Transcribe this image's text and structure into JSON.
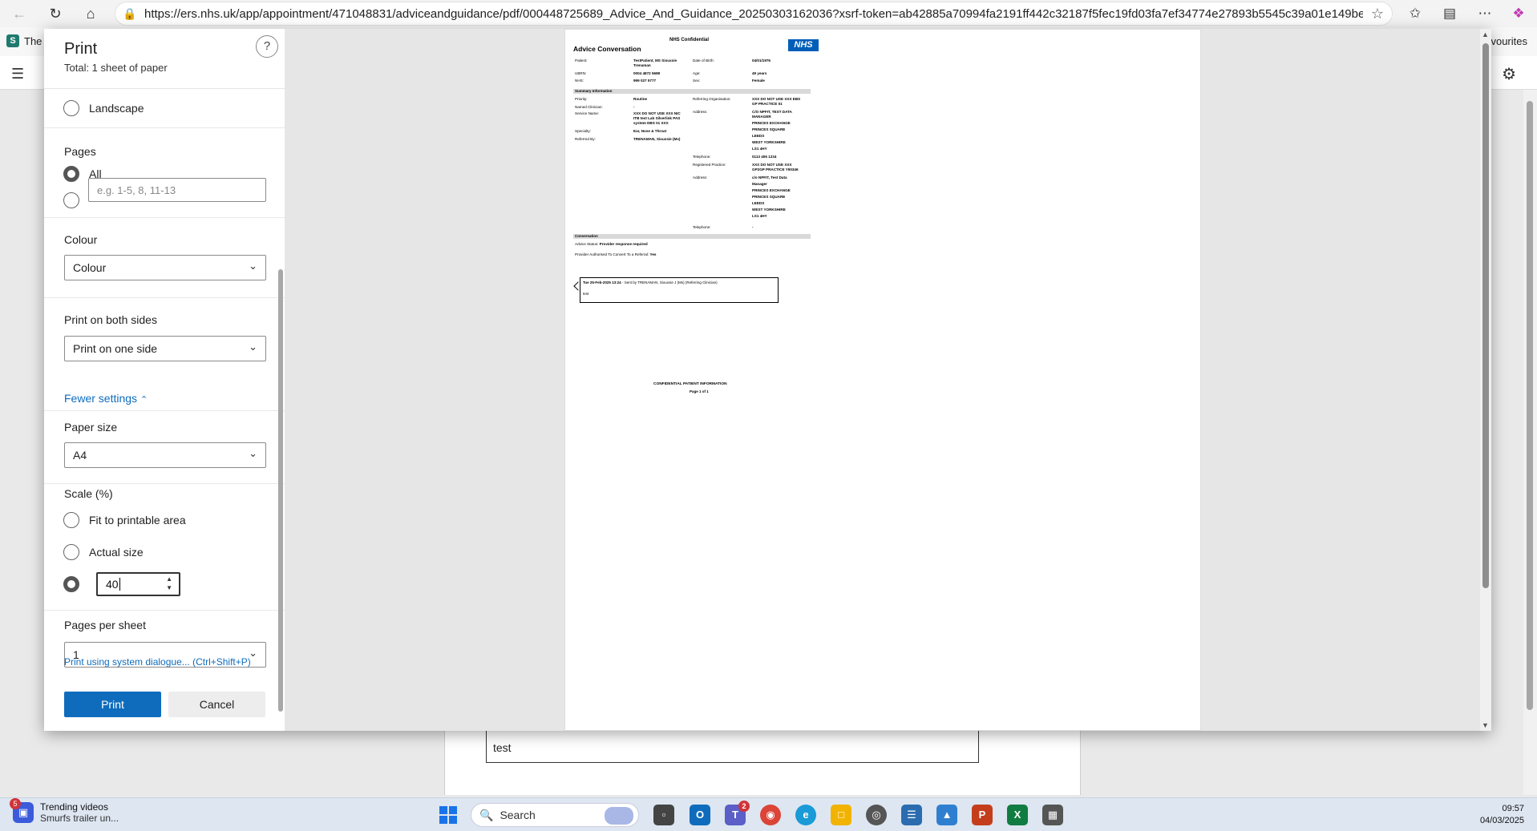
{
  "browser": {
    "url": "https://ers.nhs.uk/app/appointment/471048831/adviceandguidance/pdf/000448725689_Advice_And_Guidance_20250303162036?xsrf-token=ab42885a70994fa2191ff442c32187f5fec19fd03fa7ef34774e27893b5545c39a01e149bec8fc9556d18...",
    "fav_left": "The",
    "fav_right": "vourites"
  },
  "print": {
    "title": "Print",
    "subtitle": "Total: 1 sheet of paper",
    "help": "?",
    "landscape_label": "Landscape",
    "pages_label": "Pages",
    "pages_all": "All",
    "pages_placeholder": "e.g. 1-5, 8, 11-13",
    "colour_label": "Colour",
    "colour_value": "Colour",
    "both_sides_label": "Print on both sides",
    "both_sides_value": "Print on one side",
    "fewer_settings": "Fewer settings",
    "paper_size_label": "Paper size",
    "paper_size_value": "A4",
    "scale_label": "Scale (%)",
    "scale_fit": "Fit to printable area",
    "scale_actual": "Actual size",
    "scale_value": "40",
    "pps_label": "Pages per sheet",
    "pps_value": "1",
    "system_dialog": "Print using system dialogue... (Ctrl+Shift+P)",
    "print_btn": "Print",
    "cancel_btn": "Cancel"
  },
  "doc": {
    "confidential": "NHS Confidential",
    "title": "Advice Conversation",
    "nhs": "NHS",
    "patient_k": "Patient:",
    "patient_v1": "TestPatient, MS Siouxsie",
    "patient_v2": "Trenaman",
    "dob_k": "Date of Birth:",
    "dob_v": "04/01/1976",
    "ubrn_k": "UBRN:",
    "ubrn_v": "0004 4872 5689",
    "age_k": "Age:",
    "age_v": "49 years",
    "nhs_k": "NHS:",
    "nhs_v": "999 027 5777",
    "sex_k": "Sex:",
    "sex_v": "Female",
    "summary": "Summary Information",
    "priority_k": "Priority:",
    "priority_v": "Routine",
    "ref_org_k": "Referring Organisation:",
    "ref_org_v1": "XXX DO NOT USE XXX EBS",
    "ref_org_v2": "GP PRACTICE 01",
    "named_k": "Named Clinician:",
    "named_v": "-",
    "service_k": "Service Name:",
    "service_v1": "XXX DO NOT USE XXX NIC",
    "service_v2": "ITB test Lab Silverlink PAS",
    "service_v3": "system DBS 01 XXX",
    "address_k": "Address:",
    "addr1_1": "C/O NPFIT, TEST DATA",
    "addr1_2": "MANAGER",
    "addr1_3": "PRINCES EXCHANGE",
    "addr1_4": "PRINCES SQUARE",
    "addr1_5": "LEEDS",
    "addr1_6": "WEST YORKSHIRE",
    "addr1_7": "LS1 4HY",
    "specialty_k": "Specialty:",
    "specialty_v": "Ear, Nose & Throat",
    "referred_k": "Referred By:",
    "referred_v": "TRENAMAN, Siouxsie (Ms)",
    "tel_k": "Telephone:",
    "tel_v": "0113 406 1234",
    "reg_k": "Registered Practice:",
    "reg_v1": "XXX DO NOT USE XXX",
    "reg_v2": "GP2GP PRACTICE Y90346",
    "addr2_1": "c/o NPFIT, Test Data",
    "addr2_2": "Manager",
    "addr2_3": "PRINCES EXCHANGE",
    "addr2_4": "PRINCES SQUARE",
    "addr2_5": "LEEDS",
    "addr2_6": "WEST YORKSHIRE",
    "addr2_7": "LS1 4HY",
    "tel2_v": "-",
    "conversation": "Conversation",
    "advice_status_k": "Advice Status:",
    "advice_status_v": "Provider response required",
    "authorised_k": "Provider Authorised To Convert To a Referral:",
    "authorised_v": "Yes",
    "msg_head": "Tue 25-Feb-2025 13:24",
    "msg_sent": " - Sent by TRENAMAN, Siouxsie J (Ms) (Referring Clinician)",
    "msg_body": "test",
    "footer_conf": "CONFIDENTIAL PATIENT INFORMATION",
    "footer_page": "Page 1 of 1"
  },
  "background": {
    "bubble_text": "test"
  },
  "taskbar": {
    "widget_badge": "5",
    "widget_title": "Trending videos",
    "widget_sub": "Smurfs trailer un...",
    "search": "Search",
    "teams_badge": "2",
    "time": "09:57",
    "date": "04/03/2025"
  }
}
